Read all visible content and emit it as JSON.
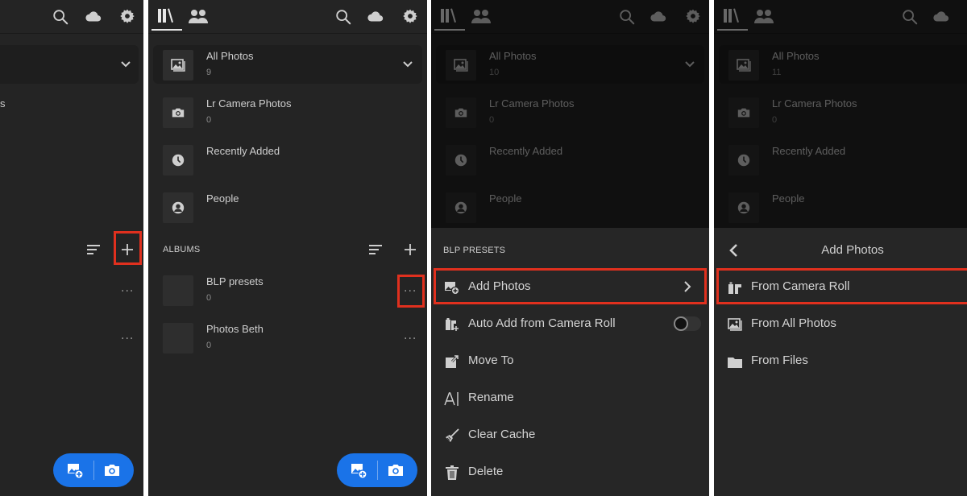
{
  "colors": {
    "background": "#242424",
    "accent_blue": "#1a73e8",
    "highlight_red": "#e0301e",
    "text_primary": "#cfcfcf",
    "text_secondary": "#8a8a8a"
  },
  "topbar": {
    "tabs": [
      {
        "name": "library",
        "icon": "library-icon",
        "active": true
      },
      {
        "name": "people",
        "icon": "people-icon",
        "active": false
      }
    ],
    "actions": [
      {
        "icon": "search-icon"
      },
      {
        "icon": "cloud-icon"
      },
      {
        "icon": "gear-icon"
      }
    ]
  },
  "panel1": {
    "partial_text": "s",
    "fab": {
      "left_icon": "add-photo-icon",
      "right_icon": "camera-icon"
    }
  },
  "panel2": {
    "library": [
      {
        "title": "All Photos",
        "count": "9",
        "icon": "photos-icon"
      },
      {
        "title": "Lr Camera Photos",
        "count": "0",
        "icon": "camera-icon"
      },
      {
        "title": "Recently Added",
        "count": "",
        "icon": "clock-icon"
      },
      {
        "title": "People",
        "count": "",
        "icon": "person-icon"
      }
    ],
    "albums_label": "ALBUMS",
    "albums": [
      {
        "title": "BLP presets",
        "count": "0"
      },
      {
        "title": "Photos Beth",
        "count": "0"
      }
    ],
    "more_label": "···",
    "fab": {
      "left_icon": "add-photo-icon",
      "right_icon": "camera-icon"
    }
  },
  "panel3": {
    "library": [
      {
        "title": "All Photos",
        "count": "10"
      },
      {
        "title": "Lr Camera Photos",
        "count": "0"
      },
      {
        "title": "Recently Added",
        "count": ""
      },
      {
        "title": "People",
        "count": ""
      }
    ],
    "sheet_title": "BLP PRESETS",
    "menu": [
      {
        "label": "Add Photos",
        "icon": "add-photo-icon",
        "has_chevron": true
      },
      {
        "label": "Auto Add from Camera Roll",
        "icon": "auto-add-icon",
        "toggle": false
      },
      {
        "label": "Move To",
        "icon": "move-to-icon"
      },
      {
        "label": "Rename",
        "icon": "rename-icon"
      },
      {
        "label": "Clear Cache",
        "icon": "broom-icon"
      },
      {
        "label": "Delete",
        "icon": "trash-icon"
      }
    ]
  },
  "panel4": {
    "library": [
      {
        "title": "All Photos",
        "count": "11"
      },
      {
        "title": "Lr Camera Photos",
        "count": "0"
      },
      {
        "title": "Recently Added",
        "count": ""
      },
      {
        "title": "People",
        "count": ""
      }
    ],
    "sheet_title": "Add Photos",
    "menu": [
      {
        "label": "From Camera Roll",
        "icon": "camera-roll-icon"
      },
      {
        "label": "From All Photos",
        "icon": "photos-icon"
      },
      {
        "label": "From Files",
        "icon": "folder-icon"
      }
    ]
  }
}
